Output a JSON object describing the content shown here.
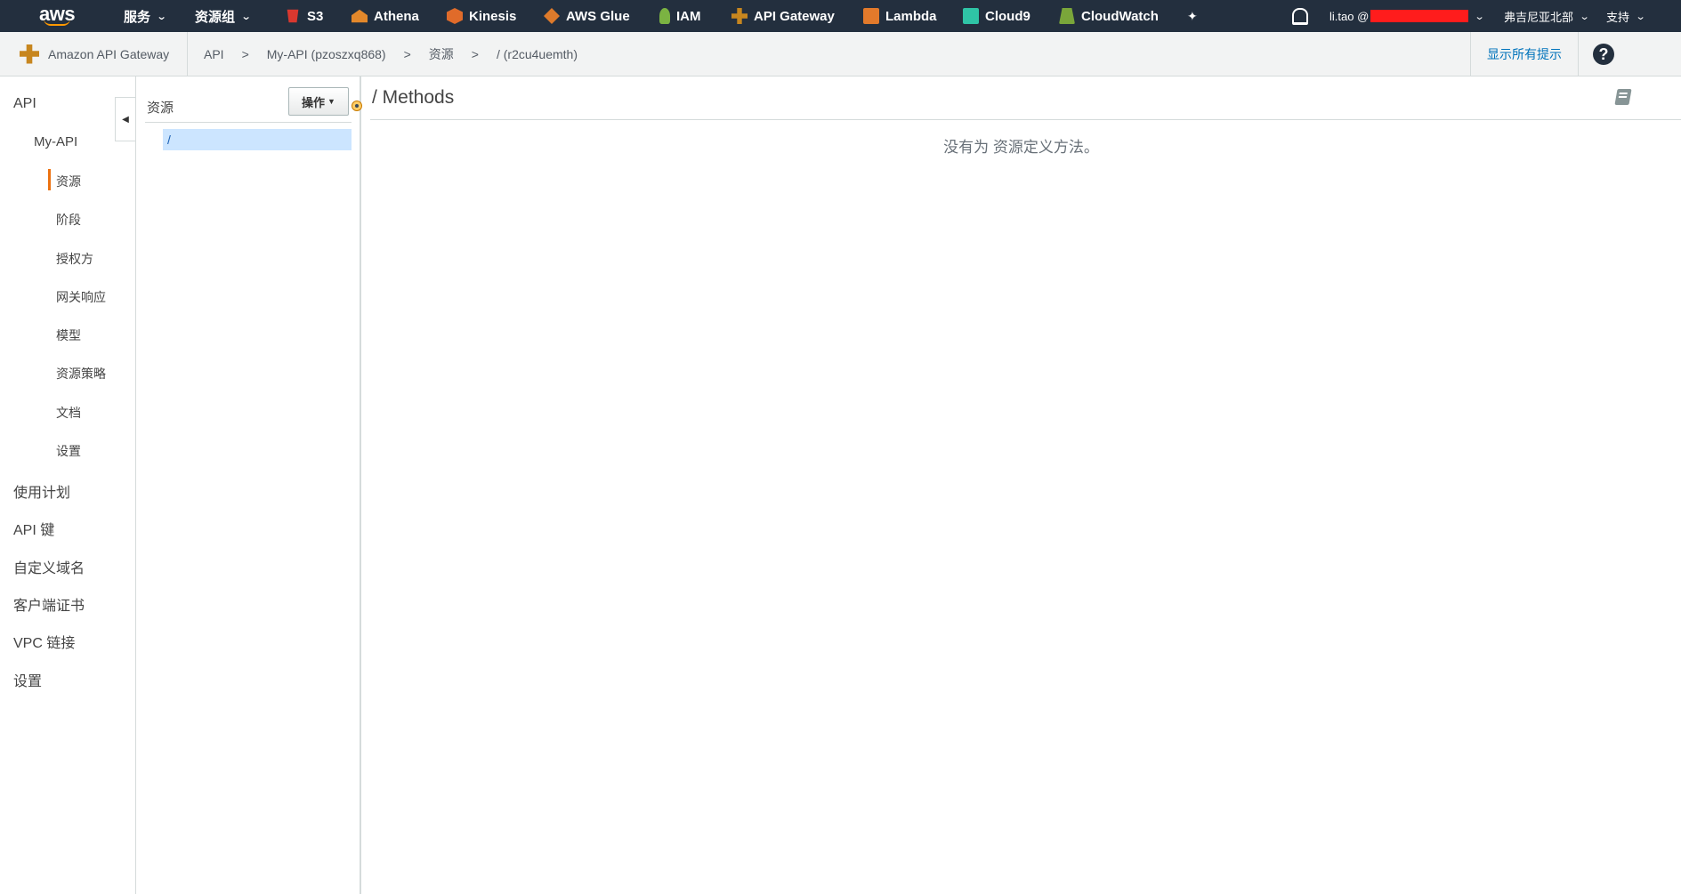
{
  "topnav": {
    "logo": "aws",
    "services": "服务",
    "resource_groups": "资源组",
    "shortcuts": [
      "S3",
      "Athena",
      "Kinesis",
      "AWS Glue",
      "IAM",
      "API Gateway",
      "Lambda",
      "Cloud9",
      "CloudWatch"
    ],
    "user": "li.tao @",
    "region": "弗吉尼亚北部",
    "support": "支持"
  },
  "subbar": {
    "service_name": "Amazon API Gateway",
    "breadcrumbs": [
      "API",
      "My-API (pzoszxq868)",
      "资源",
      "/ (r2cu4uemth)"
    ],
    "breadcrumb_sep": ">",
    "show_hints": "显示所有提示",
    "help": "?"
  },
  "leftnav": {
    "api": "API",
    "my_api": "My-API",
    "sub_items": [
      "资源",
      "阶段",
      "授权方",
      "网关响应",
      "模型",
      "资源策略",
      "文档",
      "设置"
    ],
    "top_items": [
      "使用计划",
      "API 键",
      "自定义域名",
      "客户端证书",
      "VPC 链接",
      "设置"
    ]
  },
  "resources": {
    "title": "资源",
    "actions": "操作",
    "tree": [
      "/"
    ]
  },
  "main": {
    "title": "/ Methods",
    "empty_message": "没有为 资源定义方法。"
  },
  "colors": {
    "nav_bg": "#232f3e",
    "accent": "#ec7211",
    "link": "#0073bb",
    "selection": "#cce5ff"
  }
}
